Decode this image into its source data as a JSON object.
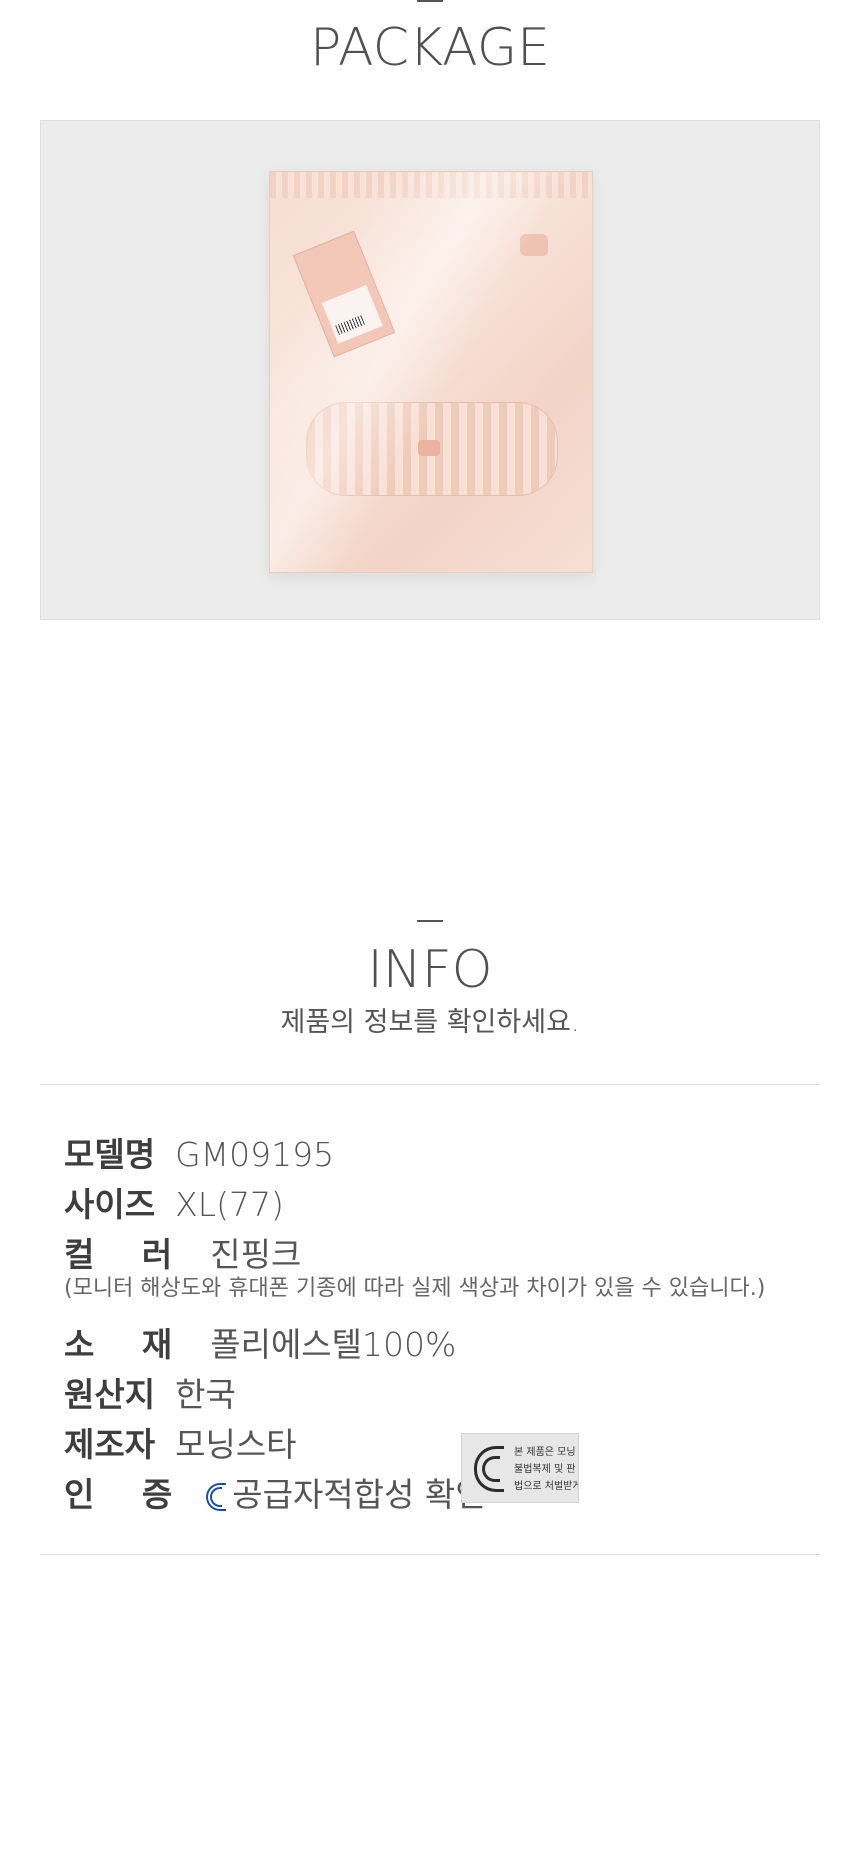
{
  "package": {
    "title": "PACKAGE"
  },
  "info": {
    "title": "INFO",
    "subtitle": "제품의 정보를 확인하세요.",
    "rows": [
      {
        "label": "모델명",
        "value": "GM09195"
      },
      {
        "label": "사이즈",
        "value": "XL(77)"
      },
      {
        "label": "컬 러",
        "value": "진핑크"
      },
      {
        "label": "소 재",
        "value": "폴리에스텔100%"
      },
      {
        "label": "원산지",
        "value": "한국"
      },
      {
        "label": "제조자",
        "value": "모닝스타"
      },
      {
        "label": "인 증",
        "value": "공급자적합성 확인"
      }
    ],
    "color_note": "(모니터 해상도와 휴대폰 기종에 따라 실제 색상과 차이가 있을 수 있습니다.)",
    "kc_notice": {
      "line1": "본 제품은 모닝",
      "line2": "불법복제 및 판",
      "line3": "법으로 처벌받게"
    }
  }
}
